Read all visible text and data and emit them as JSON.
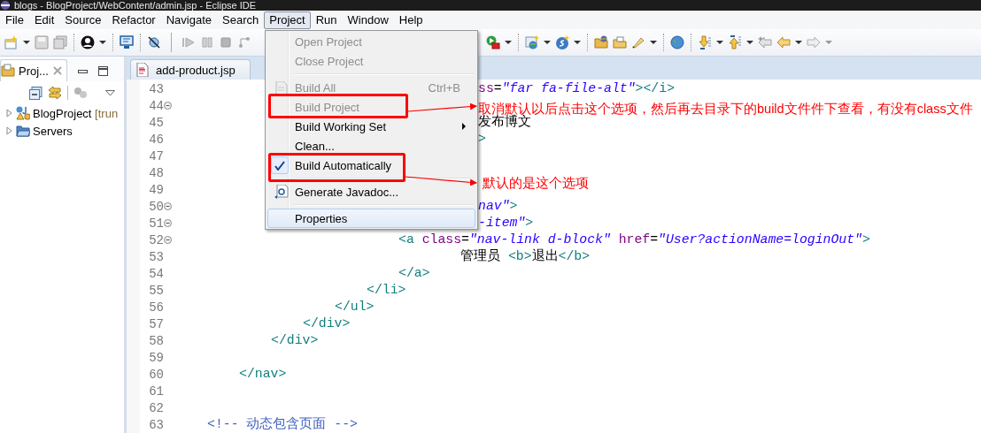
{
  "window": {
    "title": "blogs - BlogProject/WebContent/admin.jsp - Eclipse IDE"
  },
  "menu_bar": [
    {
      "label": "File",
      "selected": false
    },
    {
      "label": "Edit",
      "selected": false
    },
    {
      "label": "Source",
      "selected": false
    },
    {
      "label": "Refactor",
      "selected": false
    },
    {
      "label": "Navigate",
      "selected": false
    },
    {
      "label": "Search",
      "selected": false
    },
    {
      "label": "Project",
      "selected": true
    },
    {
      "label": "Run",
      "selected": false
    },
    {
      "label": "Window",
      "selected": false
    },
    {
      "label": "Help",
      "selected": false
    }
  ],
  "explorer": {
    "tab": {
      "label": "Proj...",
      "selected": true
    },
    "tree": [
      {
        "label": "BlogProject",
        "decoration": "[trun",
        "expanded": false
      },
      {
        "label": "Servers",
        "expanded": false
      }
    ]
  },
  "editor": {
    "tabs": [
      {
        "label": "add-product.jsp",
        "selected": false
      }
    ],
    "lines": [
      {
        "number": "43",
        "foldable": false,
        "tokens": [
          {
            "kind": "attr",
            "text": "ss"
          },
          {
            "kind": "plain",
            "text": "="
          },
          {
            "kind": "value",
            "text": "\"far fa-file-alt\""
          },
          {
            "kind": "tag",
            "text": "></i>"
          }
        ]
      },
      {
        "number": "44",
        "foldable": true
      },
      {
        "number": "45",
        "foldable": false,
        "tokens": [
          {
            "kind": "text",
            "text": "发布博文"
          }
        ]
      },
      {
        "number": "46",
        "foldable": false,
        "tokens": [
          {
            "kind": "tag",
            "text": ">"
          }
        ]
      },
      {
        "number": "47",
        "foldable": false
      },
      {
        "number": "48",
        "foldable": false
      },
      {
        "number": "49",
        "foldable": false
      },
      {
        "number": "50",
        "foldable": true,
        "tokens": [
          {
            "kind": "value",
            "text": "nav\""
          },
          {
            "kind": "tag",
            "text": ">"
          }
        ]
      },
      {
        "number": "51",
        "foldable": true,
        "tokens": [
          {
            "kind": "value",
            "text": "-item\""
          },
          {
            "kind": "tag",
            "text": ">"
          }
        ]
      },
      {
        "number": "52",
        "foldable": true,
        "tokens": [
          {
            "kind": "tag",
            "text": "<a "
          },
          {
            "kind": "attr",
            "text": "class"
          },
          {
            "kind": "plain",
            "text": "="
          },
          {
            "kind": "value",
            "text": "\"nav-link d-block\""
          },
          {
            "kind": "attr",
            "text": " href"
          },
          {
            "kind": "plain",
            "text": "="
          },
          {
            "kind": "value",
            "text": "\"User?actionName=loginOut\""
          },
          {
            "kind": "tag",
            "text": ">"
          }
        ]
      },
      {
        "number": "53",
        "foldable": false,
        "tokens": [
          {
            "kind": "text",
            "text": "管理员 "
          },
          {
            "kind": "tag",
            "text": "<b>"
          },
          {
            "kind": "text",
            "text": "退出"
          },
          {
            "kind": "tag",
            "text": "</b>"
          }
        ]
      },
      {
        "number": "54",
        "foldable": false,
        "tokens": [
          {
            "kind": "tag",
            "text": "</a>"
          }
        ]
      },
      {
        "number": "55",
        "foldable": false,
        "tokens": [
          {
            "kind": "tag",
            "text": "</li>"
          }
        ]
      },
      {
        "number": "56",
        "foldable": false,
        "tokens": [
          {
            "kind": "tag",
            "text": "</ul>"
          }
        ]
      },
      {
        "number": "57",
        "foldable": false,
        "tokens": [
          {
            "kind": "tag",
            "text": "</div>"
          }
        ]
      },
      {
        "number": "58",
        "foldable": false,
        "tokens": [
          {
            "kind": "tag",
            "text": "</div>"
          }
        ]
      },
      {
        "number": "59",
        "foldable": false
      },
      {
        "number": "60",
        "foldable": false,
        "tokens": [
          {
            "kind": "tag",
            "text": "</nav>"
          }
        ]
      },
      {
        "number": "61",
        "foldable": false
      },
      {
        "number": "62",
        "foldable": false
      },
      {
        "number": "63",
        "foldable": false,
        "tokens": [
          {
            "kind": "comment",
            "text": "<!-- 动态包含页面 -->"
          }
        ]
      }
    ]
  },
  "project_menu": {
    "items": [
      {
        "kind": "item",
        "label": "Open Project",
        "disabled": true,
        "checked": false,
        "submenu": false,
        "hovered": false
      },
      {
        "kind": "item",
        "label": "Close Project",
        "disabled": true,
        "checked": false,
        "submenu": false,
        "hovered": false
      },
      {
        "kind": "separator"
      },
      {
        "kind": "item",
        "label": "Build All",
        "shortcut": "Ctrl+B",
        "disabled": true,
        "checked": false,
        "submenu": false,
        "hovered": false
      },
      {
        "kind": "item",
        "label": "Build Project",
        "disabled": true,
        "checked": false,
        "submenu": false,
        "hovered": false
      },
      {
        "kind": "item",
        "label": "Build Working Set",
        "disabled": false,
        "checked": false,
        "submenu": true,
        "hovered": false
      },
      {
        "kind": "item",
        "label": "Clean...",
        "disabled": false,
        "checked": false,
        "submenu": false,
        "hovered": false
      },
      {
        "kind": "item",
        "label": "Build Automatically",
        "disabled": false,
        "checked": true,
        "submenu": false,
        "hovered": false
      },
      {
        "kind": "separator"
      },
      {
        "kind": "item",
        "label": "Generate Javadoc...",
        "disabled": false,
        "checked": false,
        "submenu": false,
        "hovered": false
      },
      {
        "kind": "separator"
      },
      {
        "kind": "item",
        "label": "Properties",
        "disabled": false,
        "checked": false,
        "submenu": false,
        "hovered": true
      }
    ]
  },
  "annotations": [
    {
      "text": "取消默认以后点击这个选项，然后再去目录下的build文件件下查看，有没有class文件"
    },
    {
      "text": "默认的是这个选项"
    }
  ]
}
